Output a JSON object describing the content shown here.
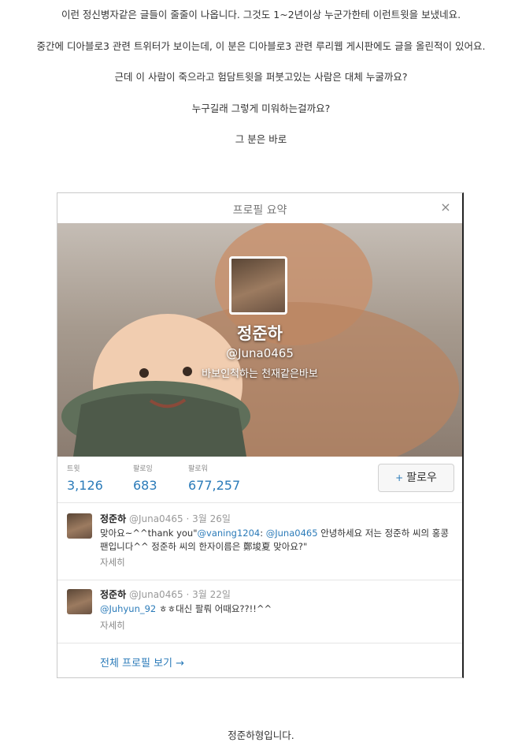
{
  "post": {
    "lines": [
      "이런 정신병자같은 글들이 줄줄이 나옵니다. 그것도 1~2년이상 누군가한테 이런트윗을 보냈네요.",
      "중간에 디아블로3 관련 트위터가 보이는데, 이 분은 디아블로3 관련 루리웹 게시판에도 글을 올린적이 있어요.",
      "근데 이 사람이 죽으라고 험담트윗을 퍼붓고있는 사람은 대체 누굴까요?",
      "누구길래 그렇게 미워하는걸까요?",
      "그 분은 바로"
    ],
    "footer": "정준하형입니다."
  },
  "card": {
    "title": "프로필 요약",
    "close": "×",
    "name": "정준하",
    "handle": "@Juna0465",
    "bio": "바보인척하는 천재같은바보",
    "stats": [
      {
        "label": "트윗",
        "value": "3,126"
      },
      {
        "label": "팔로잉",
        "value": "683"
      },
      {
        "label": "팔로워",
        "value": "677,257"
      }
    ],
    "follow_label": "팔로우",
    "follow_icon": "+",
    "tweets": [
      {
        "name": "정준하",
        "handle": "@Juna0465",
        "date": "3월 26일",
        "line1_pre": "맞아요~^^thank you\"",
        "line1_mention1": "@vaning1204",
        "line1_mid": ": ",
        "line1_mention2": "@Juna0465",
        "line1_post": " 안녕하세요 저는 정준하 씨의 홍콩",
        "line2": "팬입니다^^ 정준하 씨의 한자이름은 鄭埈夏 맞아요?\"",
        "more": "자세히"
      },
      {
        "name": "정준하",
        "handle": "@Juna0465",
        "date": "3월 22일",
        "line1_mention1": "@Juhyun_92",
        "line1_post": " ㅎㅎ대신 팔뤄 어때요??!!^^",
        "more": "자세히"
      }
    ],
    "full_profile": "전체 프로필 보기 →"
  }
}
